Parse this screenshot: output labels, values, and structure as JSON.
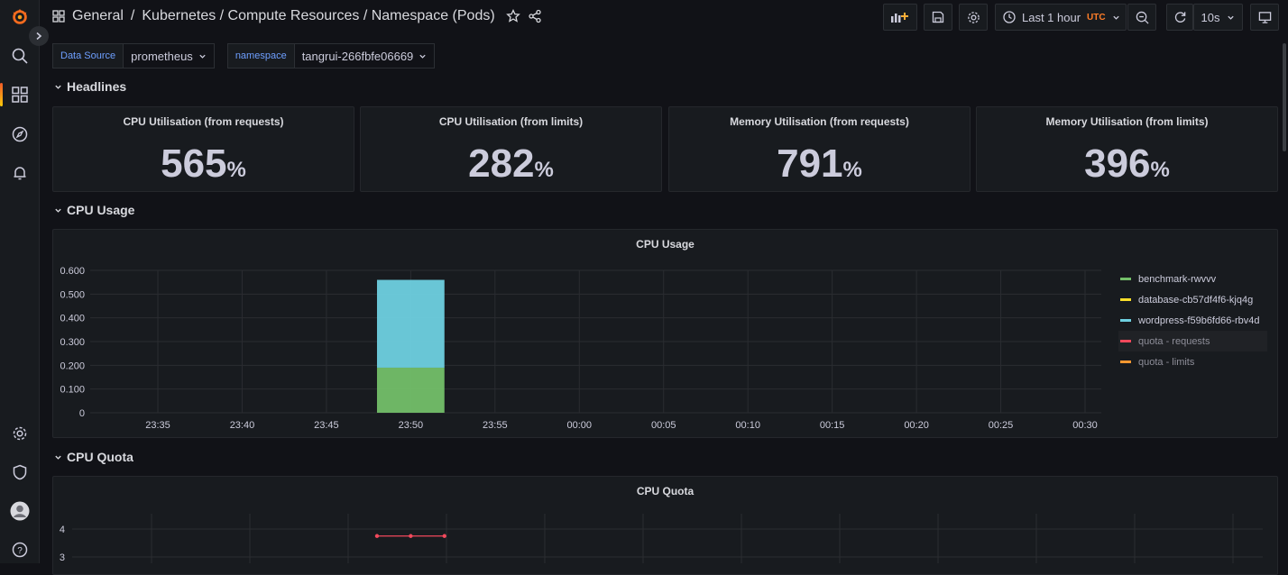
{
  "breadcrumb": {
    "folder": "General",
    "dashboard": "Kubernetes / Compute Resources / Namespace (Pods)"
  },
  "toolbar": {
    "time_range": "Last 1 hour",
    "timezone": "UTC",
    "refresh": "10s"
  },
  "variables": [
    {
      "label": "Data Source",
      "value": "prometheus"
    },
    {
      "label": "namespace",
      "value": "tangrui-266fbfe06669"
    }
  ],
  "rows": {
    "headlines": "Headlines",
    "cpu_usage": "CPU Usage",
    "cpu_quota": "CPU Quota"
  },
  "stats": [
    {
      "title": "CPU Utilisation (from requests)",
      "value": "565",
      "unit": "%"
    },
    {
      "title": "CPU Utilisation (from limits)",
      "value": "282",
      "unit": "%"
    },
    {
      "title": "Memory Utilisation (from requests)",
      "value": "791",
      "unit": "%"
    },
    {
      "title": "Memory Utilisation (from limits)",
      "value": "396",
      "unit": "%"
    }
  ],
  "chart_data": [
    {
      "type": "bar",
      "title": "CPU Usage",
      "x_ticks": [
        "23:35",
        "23:40",
        "23:45",
        "23:50",
        "23:55",
        "00:00",
        "00:05",
        "00:10",
        "00:15",
        "00:20",
        "00:25",
        "00:30"
      ],
      "y_ticks": [
        "0",
        "0.100",
        "0.200",
        "0.300",
        "0.400",
        "0.500",
        "0.600"
      ],
      "ylim": [
        0,
        0.6
      ],
      "stacked": true,
      "bar": {
        "x_start": "23:48",
        "x_end": "23:52"
      },
      "series": [
        {
          "name": "benchmark-rwvvv",
          "color": "#73bf69",
          "value": 0.19
        },
        {
          "name": "database-cb57df4f6-kjq4g",
          "color": "#fade2a",
          "value": 0
        },
        {
          "name": "wordpress-f59b6fd66-rbv4d",
          "color": "#6ed0e0",
          "value": 0.37
        },
        {
          "name": "quota - requests",
          "color": "#f2495c",
          "value": null
        },
        {
          "name": "quota - limits",
          "color": "#ff9830",
          "value": null
        }
      ]
    },
    {
      "type": "line",
      "title": "CPU Quota",
      "y_ticks": [
        "3",
        "4"
      ],
      "series": [
        {
          "color": "#f2495c",
          "x": [
            "23:48",
            "23:50",
            "23:52"
          ],
          "y": [
            3.75,
            3.75,
            3.75
          ]
        }
      ]
    }
  ]
}
